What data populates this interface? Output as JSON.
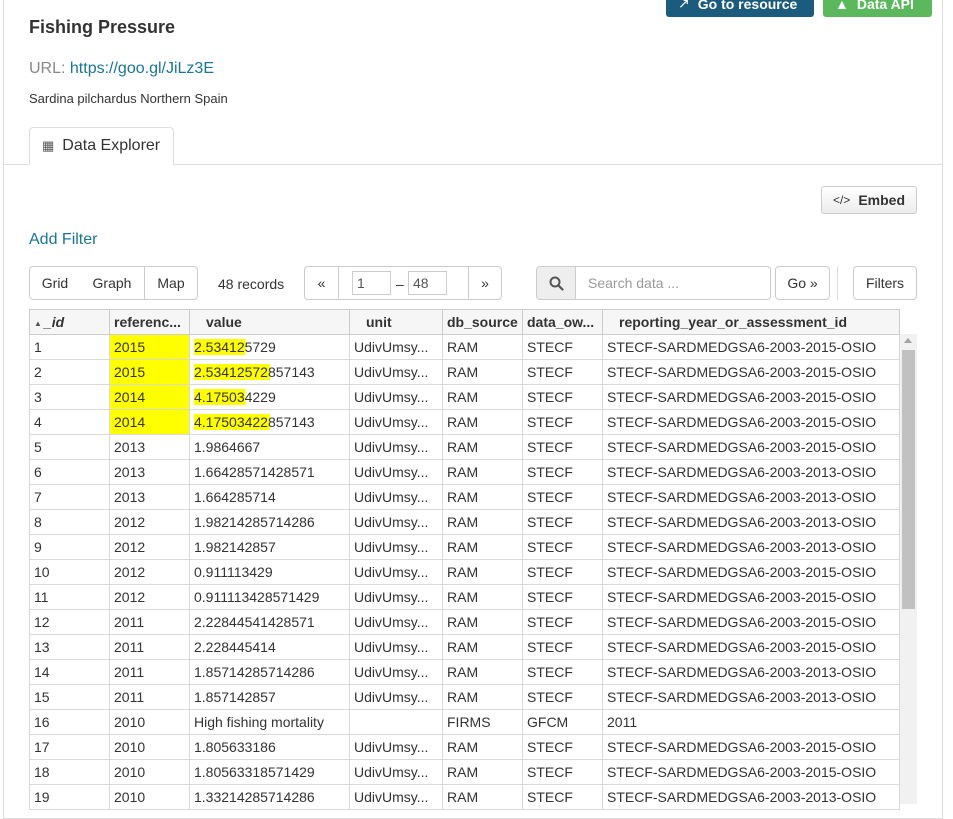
{
  "header": {
    "go_to_resource": "Go to resource",
    "data_api": "Data API",
    "title": "Fishing Pressure",
    "url_label": "URL:",
    "url_value": "https://goo.gl/JiLz3E",
    "description": "Sardina pilchardus Northern Spain"
  },
  "tabs": {
    "data_explorer": "Data Explorer"
  },
  "toolbar": {
    "embed": "Embed",
    "add_filter": "Add Filter",
    "view_grid": "Grid",
    "view_graph": "Graph",
    "view_map": "Map",
    "records": "48 records",
    "prev": "«",
    "next": "»",
    "from": "1",
    "range_sep": "–",
    "to": "48",
    "search_placeholder": "Search data ...",
    "go": "Go »",
    "filters": "Filters"
  },
  "table": {
    "columns": [
      "_id",
      "referenc...",
      "value",
      "unit",
      "db_source",
      "data_ow...",
      "reporting_year_or_assessment_id"
    ],
    "rows": [
      [
        "1",
        "2015",
        "2.534125729",
        "UdivUmsy...",
        "RAM",
        "STECF",
        "STECF-SARDMEDGSA6-2003-2015-OSIO"
      ],
      [
        "2",
        "2015",
        "2.53412572857143",
        "UdivUmsy...",
        "RAM",
        "STECF",
        "STECF-SARDMEDGSA6-2003-2015-OSIO"
      ],
      [
        "3",
        "2014",
        "4.175034229",
        "UdivUmsy...",
        "RAM",
        "STECF",
        "STECF-SARDMEDGSA6-2003-2015-OSIO"
      ],
      [
        "4",
        "2014",
        "4.17503422857143",
        "UdivUmsy...",
        "RAM",
        "STECF",
        "STECF-SARDMEDGSA6-2003-2015-OSIO"
      ],
      [
        "5",
        "2013",
        "1.9864667",
        "UdivUmsy...",
        "RAM",
        "STECF",
        "STECF-SARDMEDGSA6-2003-2015-OSIO"
      ],
      [
        "6",
        "2013",
        "1.66428571428571",
        "UdivUmsy...",
        "RAM",
        "STECF",
        "STECF-SARDMEDGSA6-2003-2013-OSIO"
      ],
      [
        "7",
        "2013",
        "1.664285714",
        "UdivUmsy...",
        "RAM",
        "STECF",
        "STECF-SARDMEDGSA6-2003-2013-OSIO"
      ],
      [
        "8",
        "2012",
        "1.98214285714286",
        "UdivUmsy...",
        "RAM",
        "STECF",
        "STECF-SARDMEDGSA6-2003-2013-OSIO"
      ],
      [
        "9",
        "2012",
        "1.982142857",
        "UdivUmsy...",
        "RAM",
        "STECF",
        "STECF-SARDMEDGSA6-2003-2013-OSIO"
      ],
      [
        "10",
        "2012",
        "0.911113429",
        "UdivUmsy...",
        "RAM",
        "STECF",
        "STECF-SARDMEDGSA6-2003-2015-OSIO"
      ],
      [
        "11",
        "2012",
        "0.911113428571429",
        "UdivUmsy...",
        "RAM",
        "STECF",
        "STECF-SARDMEDGSA6-2003-2015-OSIO"
      ],
      [
        "12",
        "2011",
        "2.22844541428571",
        "UdivUmsy...",
        "RAM",
        "STECF",
        "STECF-SARDMEDGSA6-2003-2015-OSIO"
      ],
      [
        "13",
        "2011",
        "2.228445414",
        "UdivUmsy...",
        "RAM",
        "STECF",
        "STECF-SARDMEDGSA6-2003-2015-OSIO"
      ],
      [
        "14",
        "2011",
        "1.85714285714286",
        "UdivUmsy...",
        "RAM",
        "STECF",
        "STECF-SARDMEDGSA6-2003-2013-OSIO"
      ],
      [
        "15",
        "2011",
        "1.857142857",
        "UdivUmsy...",
        "RAM",
        "STECF",
        "STECF-SARDMEDGSA6-2003-2013-OSIO"
      ],
      [
        "16",
        "2010",
        "High fishing mortality",
        "",
        "FIRMS",
        "GFCM",
        "2011"
      ],
      [
        "17",
        "2010",
        "1.805633186",
        "UdivUmsy...",
        "RAM",
        "STECF",
        "STECF-SARDMEDGSA6-2003-2015-OSIO"
      ],
      [
        "18",
        "2010",
        "1.80563318571429",
        "UdivUmsy...",
        "RAM",
        "STECF",
        "STECF-SARDMEDGSA6-2003-2015-OSIO"
      ],
      [
        "19",
        "2010",
        "1.33214285714286",
        "UdivUmsy...",
        "RAM",
        "STECF",
        "STECF-SARDMEDGSA6-2003-2013-OSIO"
      ]
    ]
  },
  "highlight_color": "#ffff00",
  "accent_color": "#187794"
}
